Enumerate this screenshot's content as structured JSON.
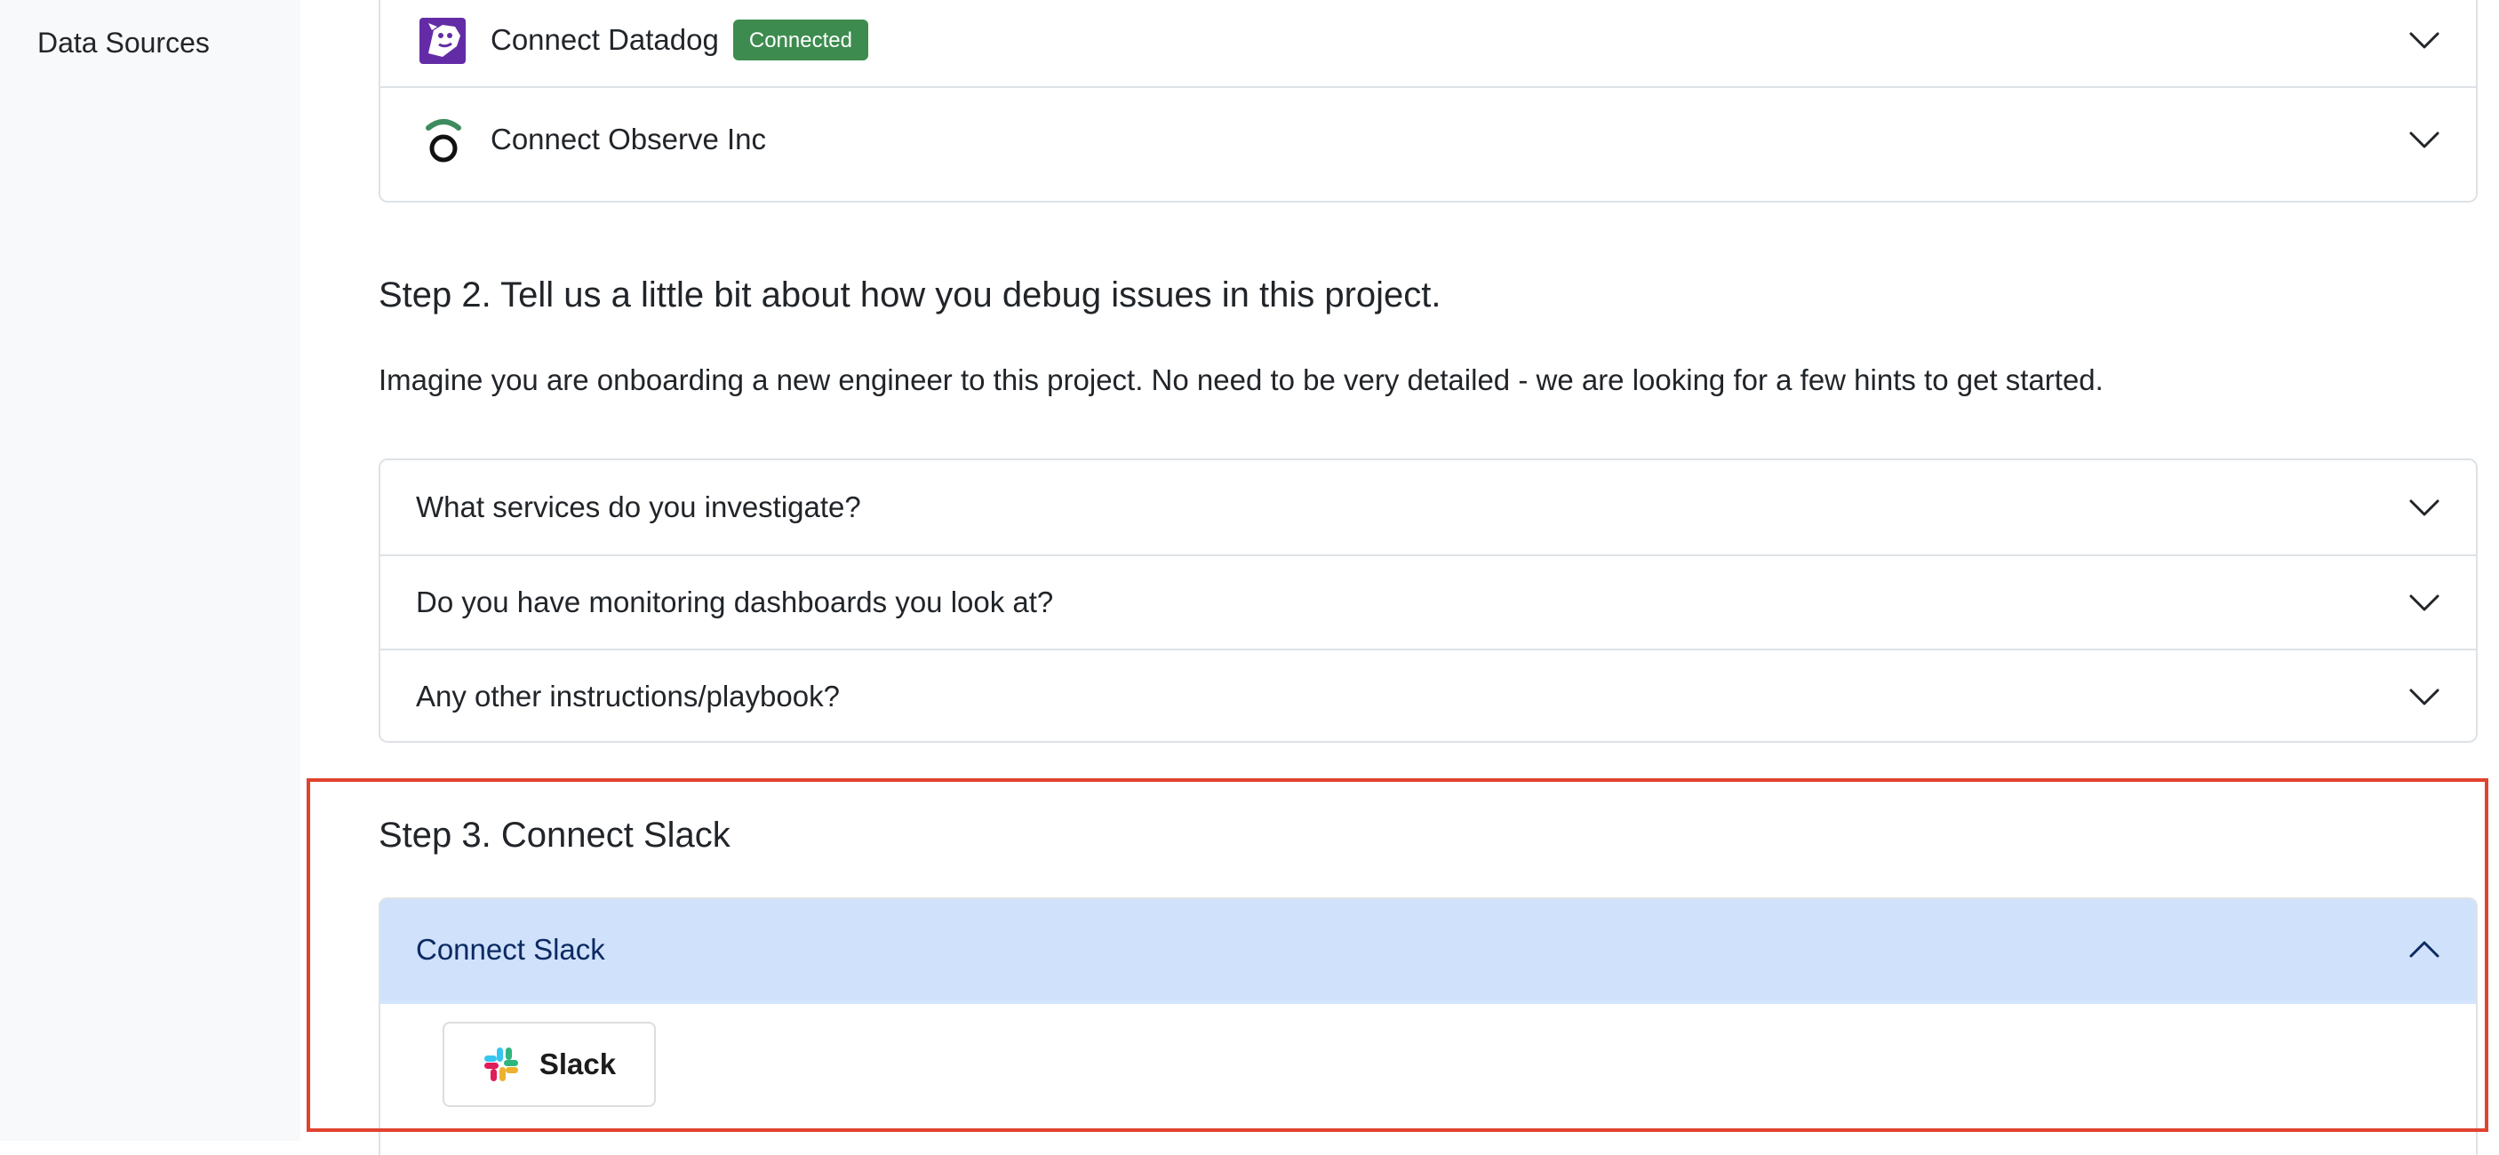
{
  "sidebar": {
    "items": [
      {
        "label": "Data Sources"
      }
    ]
  },
  "step1": {
    "integrations": [
      {
        "label": "Connect Datadog",
        "icon": "datadog-logo-icon",
        "badge": "Connected",
        "badge_color": "#3d8b4f"
      },
      {
        "label": "Connect Observe Inc",
        "icon": "observe-logo-icon"
      }
    ]
  },
  "step2": {
    "heading": "Step 2. Tell us a little bit about how you debug issues in this project.",
    "description": "Imagine you are onboarding a new engineer to this project. No need to be very detailed - we are looking for a few hints to get started.",
    "questions": [
      {
        "label": "What services do you investigate?"
      },
      {
        "label": "Do you have monitoring dashboards you look at?"
      },
      {
        "label": "Any other instructions/playbook?"
      }
    ]
  },
  "step3": {
    "heading": "Step 3. Connect Slack",
    "accordion": {
      "label": "Connect Slack",
      "expanded": true,
      "button_label": "Slack",
      "button_icon": "slack-logo-icon"
    }
  },
  "colors": {
    "highlight_border": "#e0432f",
    "active_header_bg": "#d0e1fb",
    "badge_green": "#3d8b4f"
  }
}
